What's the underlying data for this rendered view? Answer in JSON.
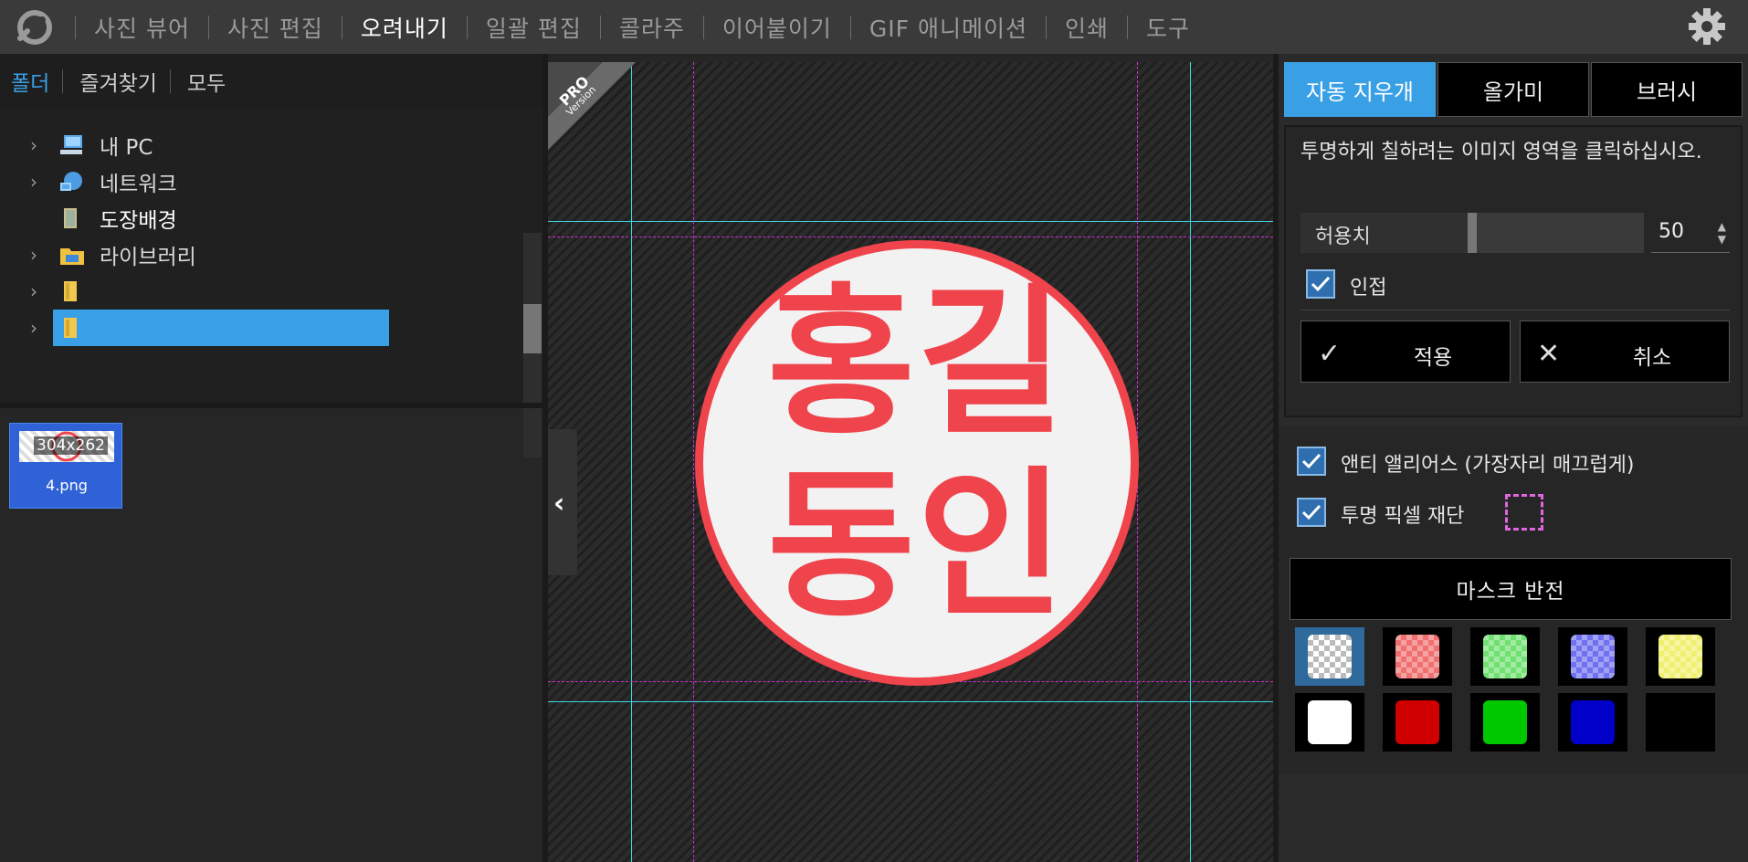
{
  "app": {
    "menu": [
      {
        "label": "사진 뷰어",
        "active": false
      },
      {
        "label": "사진 편집",
        "active": false
      },
      {
        "label": "오려내기",
        "active": true
      },
      {
        "label": "일괄 편집",
        "active": false
      },
      {
        "label": "콜라주",
        "active": false
      },
      {
        "label": "이어붙이기",
        "active": false
      },
      {
        "label": "GIF 애니메이션",
        "active": false
      },
      {
        "label": "인쇄",
        "active": false
      },
      {
        "label": "도구",
        "active": false
      }
    ]
  },
  "left": {
    "tabs": [
      "폴더",
      "즐겨찾기",
      "모두"
    ],
    "tree": [
      "내 PC",
      "네트워크",
      "도장배경",
      "라이브러리",
      "",
      ""
    ],
    "thumb": {
      "dims": "304x262",
      "name": "4.png"
    }
  },
  "canvas": {
    "pro": {
      "top": "PRO",
      "bottom": "Version"
    },
    "stamp_lines": [
      "홍길",
      "동인"
    ],
    "stamp_color": "#f0444c"
  },
  "right": {
    "tabs": [
      "자동 지우개",
      "올가미",
      "브러시"
    ],
    "hint": "투명하게 칠하려는 이미지 영역을 클릭하십시오.",
    "tolerance": {
      "label": "허용치",
      "value": 50,
      "max": 100
    },
    "adjacent_label": "인접",
    "apply_label": "적용",
    "cancel_label": "취소",
    "antialias_label": "앤티 앨리어스 (가장자리 매끄럽게)",
    "trim_label": "투명 픽셀 재단",
    "mask_invert_label": "마스크 반전",
    "swatches": [
      {
        "name": "transparent",
        "color": "checker-gray",
        "selected": true
      },
      {
        "name": "red-checker",
        "color": "#f07070",
        "selected": false
      },
      {
        "name": "green-checker",
        "color": "#70e070",
        "selected": false
      },
      {
        "name": "blue-checker",
        "color": "#7070f0",
        "selected": false
      },
      {
        "name": "yellow-checker",
        "color": "#f0f070",
        "selected": false
      },
      {
        "name": "white",
        "color": "#ffffff",
        "selected": false
      },
      {
        "name": "red",
        "color": "#d00000",
        "selected": false
      },
      {
        "name": "green",
        "color": "#00c800",
        "selected": false
      },
      {
        "name": "blue",
        "color": "#0000c8",
        "selected": false
      },
      {
        "name": "black",
        "color": "#000000",
        "selected": false
      }
    ]
  }
}
